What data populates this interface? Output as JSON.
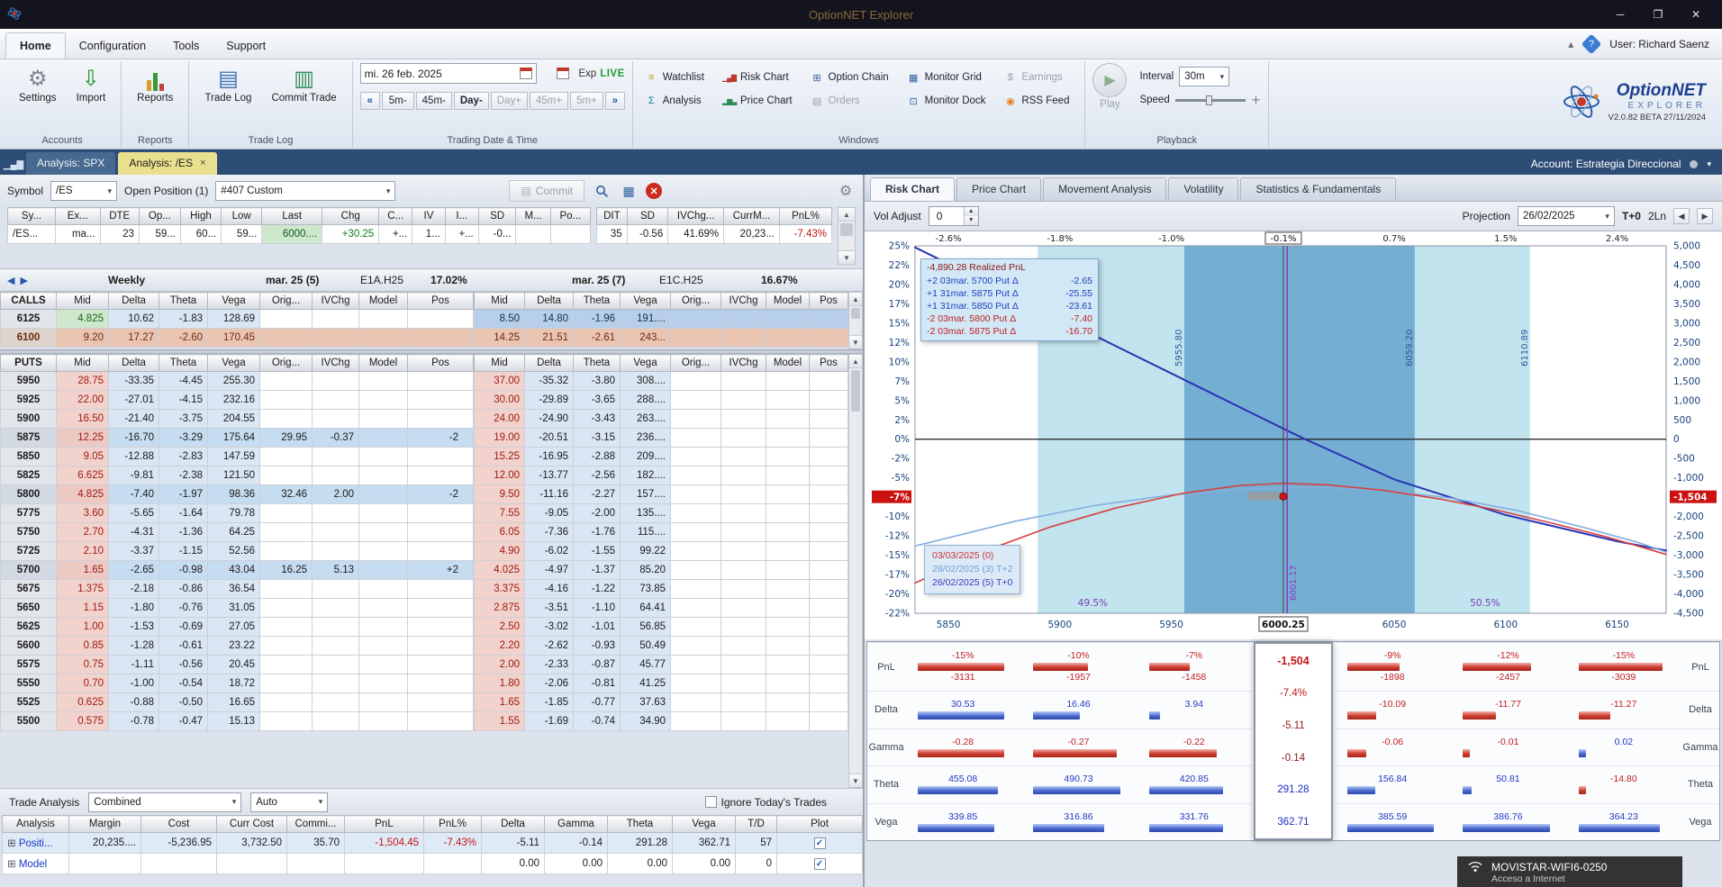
{
  "window": {
    "title": "OptionNET Explorer",
    "user": "User: Richard Saenz",
    "account": "Account: Estrategia Direccional"
  },
  "menubar": {
    "items": [
      "Home",
      "Configuration",
      "Tools",
      "Support"
    ]
  },
  "icons": {
    "settings": "⚙",
    "import": "⇩",
    "trade_log": "▤",
    "commit_trade": "▥",
    "watchlist": "≡",
    "risk_chart": "▁▄▇",
    "option_chain": "⊞",
    "monitor_grid": "▦",
    "earnings": "$",
    "analysis": "Σ",
    "price_chart": "▂▆▃",
    "orders": "▤",
    "monitor_dock": "⊡",
    "rss_feed": "◉",
    "play": "▶",
    "gear": "⚙",
    "grid": "▦",
    "close_red": "✕",
    "doc": "▤",
    "chart_tab": "▁▄▇"
  },
  "ribbon": {
    "groups": {
      "accounts": "Accounts",
      "reports": "Reports",
      "trade_log": "Trade Log",
      "date_time": "Trading Date & Time",
      "windows": "Windows",
      "playback": "Playback"
    },
    "buttons": {
      "settings": "Settings",
      "import": "Import",
      "reports": "Reports",
      "trade_log": "Trade Log",
      "commit_trade": "Commit Trade"
    },
    "date_time": {
      "date": "mi. 26 feb. 2025",
      "exp": "Exp",
      "live": "LIVE",
      "nav_back": "«",
      "nav_fwd": "»",
      "nav": [
        "5m-",
        "45m-",
        "Day-",
        "Day+",
        "45m+",
        "5m+"
      ]
    },
    "windows_row1": [
      "Watchlist",
      "Risk Chart",
      "Option Chain",
      "Monitor Grid",
      "Earnings"
    ],
    "windows_row2": [
      "Analysis",
      "Price Chart",
      "Orders",
      "Monitor Dock",
      "RSS Feed"
    ],
    "playback": {
      "play": "Play",
      "interval_label": "Interval",
      "interval_value": "30m",
      "speed_label": "Speed"
    },
    "logo": {
      "name": "OptionNET",
      "sub": "EXPLORER",
      "version": "V2.0.82 BETA 27/11/2024"
    }
  },
  "doc_tabs": {
    "spx": "Analysis: SPX",
    "es": "Analysis: /ES",
    "close": "×"
  },
  "position_bar": {
    "symbol_label": "Symbol",
    "symbol_value": "/ES",
    "open_position": "Open Position (1)",
    "strategy": "#407 Custom",
    "commit": "Commit"
  },
  "summary_table": {
    "cols_left": [
      "Sy...",
      "Ex...",
      "DTE",
      "Op...",
      "High",
      "Low",
      "Last",
      "Chg",
      "C...",
      "IV",
      "I...",
      "SD",
      "M...",
      "Po..."
    ],
    "rows_left": [
      [
        "/ES...",
        "ma...",
        "23",
        "59...",
        "60...",
        "59...",
        "6000....",
        "+30.25",
        "+...",
        "1...",
        "+...",
        "-0...",
        "",
        ""
      ]
    ],
    "cols_right": [
      "DIT",
      "SD",
      "IVChg...",
      "CurrM...",
      "PnL%"
    ],
    "rows_right": [
      [
        "35",
        "-0.56",
        "41.69%",
        "20,23...",
        "-7.43%"
      ]
    ]
  },
  "expiry_bar": {
    "cycle": "Weekly",
    "left_date": "mar. 25 (5)",
    "left_code": "E1A.H25",
    "left_iv": "17.02%",
    "right_date": "mar. 25 (7)",
    "right_code": "E1C.H25",
    "right_iv": "16.67%"
  },
  "option_tables": {
    "calls_label": "CALLS",
    "puts_label": "PUTS",
    "cols": [
      "Mid",
      "Delta",
      "Theta",
      "Vega",
      "Orig...",
      "IVChg",
      "Model",
      "Pos"
    ],
    "calls_left": [
      {
        "c": [
          "6125",
          "4.825",
          "10.62",
          "-1.83",
          "128.69",
          "",
          "",
          "",
          ""
        ]
      },
      {
        "c": [
          "6100",
          "9.20",
          "17.27",
          "-2.60",
          "170.45",
          "",
          "",
          "",
          ""
        ],
        "hl": "itm"
      }
    ],
    "calls_right": [
      {
        "c": [
          "8.50",
          "14.80",
          "-1.96",
          "191....",
          "",
          "",
          "",
          ""
        ],
        "hl": "sel"
      },
      {
        "c": [
          "14.25",
          "21.51",
          "-2.61",
          "243...",
          "",
          "",
          "",
          ""
        ],
        "hl": "itm"
      }
    ],
    "puts_left": [
      {
        "c": [
          "5950",
          "28.75",
          "-33.35",
          "-4.45",
          "255.30",
          "",
          "",
          "",
          ""
        ]
      },
      {
        "c": [
          "5925",
          "22.00",
          "-27.01",
          "-4.15",
          "232.16",
          "",
          "",
          "",
          ""
        ]
      },
      {
        "c": [
          "5900",
          "16.50",
          "-21.40",
          "-3.75",
          "204.55",
          "",
          "",
          "",
          ""
        ]
      },
      {
        "c": [
          "5875",
          "12.25",
          "-16.70",
          "-3.29",
          "175.64",
          "29.95",
          "-0.37",
          "",
          "-2"
        ],
        "hl": "pos"
      },
      {
        "c": [
          "5850",
          "9.05",
          "-12.88",
          "-2.83",
          "147.59",
          "",
          "",
          "",
          ""
        ]
      },
      {
        "c": [
          "5825",
          "6.625",
          "-9.81",
          "-2.38",
          "121.50",
          "",
          "",
          "",
          ""
        ]
      },
      {
        "c": [
          "5800",
          "4.825",
          "-7.40",
          "-1.97",
          "98.36",
          "32.46",
          "2.00",
          "",
          "-2"
        ],
        "hl": "pos"
      },
      {
        "c": [
          "5775",
          "3.60",
          "-5.65",
          "-1.64",
          "79.78",
          "",
          "",
          "",
          ""
        ]
      },
      {
        "c": [
          "5750",
          "2.70",
          "-4.31",
          "-1.36",
          "64.25",
          "",
          "",
          "",
          ""
        ]
      },
      {
        "c": [
          "5725",
          "2.10",
          "-3.37",
          "-1.15",
          "52.56",
          "",
          "",
          "",
          ""
        ]
      },
      {
        "c": [
          "5700",
          "1.65",
          "-2.65",
          "-0.98",
          "43.04",
          "16.25",
          "5.13",
          "",
          "+2"
        ],
        "hl": "pos"
      },
      {
        "c": [
          "5675",
          "1.375",
          "-2.18",
          "-0.86",
          "36.54",
          "",
          "",
          "",
          ""
        ]
      },
      {
        "c": [
          "5650",
          "1.15",
          "-1.80",
          "-0.76",
          "31.05",
          "",
          "",
          "",
          ""
        ]
      },
      {
        "c": [
          "5625",
          "1.00",
          "-1.53",
          "-0.69",
          "27.05",
          "",
          "",
          "",
          ""
        ]
      },
      {
        "c": [
          "5600",
          "0.85",
          "-1.28",
          "-0.61",
          "23.22",
          "",
          "",
          "",
          ""
        ]
      },
      {
        "c": [
          "5575",
          "0.75",
          "-1.11",
          "-0.56",
          "20.45",
          "",
          "",
          "",
          ""
        ]
      },
      {
        "c": [
          "5550",
          "0.70",
          "-1.00",
          "-0.54",
          "18.72",
          "",
          "",
          "",
          ""
        ]
      },
      {
        "c": [
          "5525",
          "0.625",
          "-0.88",
          "-0.50",
          "16.65",
          "",
          "",
          "",
          ""
        ]
      },
      {
        "c": [
          "5500",
          "0.575",
          "-0.78",
          "-0.47",
          "15.13",
          "",
          "",
          "",
          ""
        ]
      }
    ],
    "puts_right": [
      {
        "c": [
          "37.00",
          "-35.32",
          "-3.80",
          "308....",
          "",
          "",
          "",
          ""
        ]
      },
      {
        "c": [
          "30.00",
          "-29.89",
          "-3.65",
          "288....",
          "",
          "",
          "",
          ""
        ]
      },
      {
        "c": [
          "24.00",
          "-24.90",
          "-3.43",
          "263....",
          "",
          "",
          "",
          ""
        ]
      },
      {
        "c": [
          "19.00",
          "-20.51",
          "-3.15",
          "236....",
          "",
          "",
          "",
          ""
        ]
      },
      {
        "c": [
          "15.25",
          "-16.95",
          "-2.88",
          "209....",
          "",
          "",
          "",
          ""
        ]
      },
      {
        "c": [
          "12.00",
          "-13.77",
          "-2.56",
          "182....",
          "",
          "",
          "",
          ""
        ]
      },
      {
        "c": [
          "9.50",
          "-11.16",
          "-2.27",
          "157....",
          "",
          "",
          "",
          ""
        ]
      },
      {
        "c": [
          "7.55",
          "-9.05",
          "-2.00",
          "135....",
          "",
          "",
          "",
          ""
        ]
      },
      {
        "c": [
          "6.05",
          "-7.36",
          "-1.76",
          "115....",
          "",
          "",
          "",
          ""
        ]
      },
      {
        "c": [
          "4.90",
          "-6.02",
          "-1.55",
          "99.22",
          "",
          "",
          "",
          ""
        ]
      },
      {
        "c": [
          "4.025",
          "-4.97",
          "-1.37",
          "85.20",
          "",
          "",
          "",
          ""
        ]
      },
      {
        "c": [
          "3.375",
          "-4.16",
          "-1.22",
          "73.85",
          "",
          "",
          "",
          ""
        ]
      },
      {
        "c": [
          "2.875",
          "-3.51",
          "-1.10",
          "64.41",
          "",
          "",
          "",
          ""
        ]
      },
      {
        "c": [
          "2.50",
          "-3.02",
          "-1.01",
          "56.85",
          "",
          "",
          "",
          ""
        ]
      },
      {
        "c": [
          "2.20",
          "-2.62",
          "-0.93",
          "50.49",
          "",
          "",
          "",
          ""
        ]
      },
      {
        "c": [
          "2.00",
          "-2.33",
          "-0.87",
          "45.77",
          "",
          "",
          "",
          ""
        ]
      },
      {
        "c": [
          "1.80",
          "-2.06",
          "-0.81",
          "41.25",
          "",
          "",
          "",
          ""
        ]
      },
      {
        "c": [
          "1.65",
          "-1.85",
          "-0.77",
          "37.63",
          "",
          "",
          "",
          ""
        ]
      },
      {
        "c": [
          "1.55",
          "-1.69",
          "-0.74",
          "34.90",
          "",
          "",
          "",
          ""
        ]
      }
    ]
  },
  "trade_analysis": {
    "label": "Trade Analysis",
    "combined": "Combined",
    "auto": "Auto",
    "ignore": "Ignore Today's Trades"
  },
  "analysis_table": {
    "cols": [
      "Analysis",
      "Margin",
      "Cost",
      "Curr Cost",
      "Commi...",
      "PnL",
      "PnL%",
      "Delta",
      "Gamma",
      "Theta",
      "Vega",
      "T/D",
      "Plot"
    ],
    "rows": [
      {
        "c": [
          "Positi...",
          "20,235....",
          "-5,236.95",
          "3,732.50",
          "35.70",
          "-1,504.45",
          "-7.43%",
          "-5.11",
          "-0.14",
          "291.28",
          "362.71",
          "57",
          "✓"
        ],
        "hl": "sel2"
      },
      {
        "c": [
          "Model",
          "",
          "",
          "",
          "",
          "",
          "",
          "0.00",
          "0.00",
          "0.00",
          "0.00",
          "0",
          "✓"
        ]
      }
    ]
  },
  "right_panel": {
    "tabs": [
      "Risk Chart",
      "Price Chart",
      "Movement Analysis",
      "Volatility",
      "Statistics & Fundamentals"
    ],
    "vol_adjust_label": "Vol Adjust",
    "vol_adjust_value": "0",
    "projection_label": "Projection",
    "projection_date": "26/02/2025",
    "t_label": "T+0",
    "lines_label": "2Ln"
  },
  "chart_data": {
    "type": "line",
    "title": "Risk Chart — P&L vs Underlying Price",
    "x_range": [
      5835,
      6172
    ],
    "y_range_pct": [
      -22.5,
      25
    ],
    "x_ticks": [
      5850,
      5900,
      5950,
      6000.25,
      6050,
      6100,
      6150
    ],
    "x_tick_labels": [
      "5850",
      "5900",
      "5950",
      "6000.25",
      "6050",
      "6100",
      "6150"
    ],
    "current_tick_index": 3,
    "top_labels": [
      "-2.6%",
      "-1.8%",
      "-1.0%",
      "-0.1%",
      "0.7%",
      "1.5%",
      "2.4%"
    ],
    "y_left_labels": [
      "25%",
      "22%",
      "20%",
      "17%",
      "15%",
      "12%",
      "10%",
      "7%",
      "5%",
      "2%",
      "0%",
      "-2%",
      "-5%",
      "-7%",
      "-10%",
      "-12%",
      "-15%",
      "-17%",
      "-20%",
      "-22%"
    ],
    "y_right_labels": [
      "5,000",
      "4,500",
      "4,000",
      "3,500",
      "3,000",
      "2,500",
      "2,000",
      "1,500",
      "1,000",
      "500",
      "0",
      "-500",
      "-1,000",
      "-1,500",
      "-2,000",
      "-2,500",
      "-3,000",
      "-3,500",
      "-4,000",
      "-4,500"
    ],
    "highlight_index": 13,
    "left_badge": "-7%",
    "right_badge": "-1,504",
    "bands": {
      "light": [
        5890,
        6110.89
      ],
      "dark": [
        5955.8,
        6059.2
      ],
      "labels": [
        [
          "5955.80",
          5955.8
        ],
        [
          "6059.20",
          6059.2
        ],
        [
          "6110.89",
          6110.89
        ]
      ],
      "prob_left": {
        "text": "49.5%",
        "price": 5908
      },
      "prob_right": {
        "text": "50.5%",
        "price": 6084
      }
    },
    "current_price_line": {
      "price": 6000.25,
      "purple_price": 6001.17,
      "purple_label": "6001.17"
    },
    "marker": {
      "price": 6000.25,
      "pnl_pct": -7.4
    },
    "series": [
      {
        "name": "26/02/2025 (5) T+0",
        "color": "#2b35b5",
        "width": 2,
        "points": [
          [
            5835,
            24.8
          ],
          [
            5900,
            15.6
          ],
          [
            5950,
            8.5
          ],
          [
            6000,
            1.4
          ],
          [
            6010,
            0
          ],
          [
            6050,
            -5.2
          ],
          [
            6100,
            -9.8
          ],
          [
            6150,
            -13.2
          ],
          [
            6172,
            -14.4
          ]
        ]
      },
      {
        "name": "28/02/2025 (3) T+2",
        "color": "#85aee0",
        "width": 1.6,
        "points": [
          [
            5835,
            -13.8
          ],
          [
            5880,
            -10.6
          ],
          [
            5915,
            -8.6
          ],
          [
            5950,
            -7.2
          ],
          [
            5985,
            -6.4
          ],
          [
            6015,
            -6.2
          ],
          [
            6045,
            -6.6
          ],
          [
            6075,
            -7.6
          ],
          [
            6105,
            -9.2
          ],
          [
            6135,
            -11.4
          ],
          [
            6160,
            -13.4
          ],
          [
            6172,
            -14.6
          ]
        ]
      },
      {
        "name": "03/03/2025 (0)",
        "color": "#d84040",
        "width": 1.6,
        "points": [
          [
            5835,
            -18.6
          ],
          [
            5865,
            -14.6
          ],
          [
            5895,
            -11.4
          ],
          [
            5925,
            -8.9
          ],
          [
            5955,
            -7.0
          ],
          [
            5980,
            -6.0
          ],
          [
            6000,
            -5.7
          ],
          [
            6020,
            -5.9
          ],
          [
            6045,
            -6.6
          ],
          [
            6070,
            -7.7
          ],
          [
            6095,
            -9.1
          ],
          [
            6120,
            -10.8
          ],
          [
            6145,
            -12.6
          ],
          [
            6172,
            -14.9
          ]
        ]
      }
    ],
    "legend": {
      "realized": "-4,890.28 Realized PnL",
      "trades": [
        {
          "text": "+2 03mar. 5700 Put Δ",
          "value": "-2.65",
          "side": "long"
        },
        {
          "text": "+1 31mar. 5875 Put Δ",
          "value": "-25.55",
          "side": "long"
        },
        {
          "text": "+1 31mar. 5850 Put Δ",
          "value": "-23.61",
          "side": "long"
        },
        {
          "text": "-2 03mar. 5800 Put Δ",
          "value": "-7.40",
          "side": "short"
        },
        {
          "text": "-2 03mar. 5875 Put Δ",
          "value": "-16.70",
          "side": "short"
        }
      ]
    },
    "date_box": [
      {
        "text": "03/03/2025 (0)",
        "color": "#cc3333"
      },
      {
        "text": "28/02/2025 (3) T+2",
        "color": "#6f9fd8"
      },
      {
        "text": "26/02/2025 (5) T+0",
        "color": "#3a3ab5"
      }
    ]
  },
  "greeks": {
    "labels": [
      "PnL",
      "Delta",
      "Gamma",
      "Theta",
      "Vega"
    ],
    "center": {
      "price": "6000.25",
      "values": [
        "-1,504",
        "-7.4%",
        "-5.11",
        "-0.14",
        "291.28",
        "362.71"
      ]
    },
    "columns": [
      {
        "pnl_pct": "-15%",
        "pnl": "-3131",
        "delta": "30.53",
        "gamma": "-0.28",
        "theta": "455.08",
        "vega": "339.85"
      },
      {
        "pnl_pct": "-10%",
        "pnl": "-1957",
        "delta": "16.46",
        "gamma": "-0.27",
        "theta": "490.73",
        "vega": "316.86"
      },
      {
        "pnl_pct": "-7%",
        "pnl": "-1458",
        "delta": "3.94",
        "gamma": "-0.22",
        "theta": "420.85",
        "vega": "331.76"
      },
      {
        "pnl_pct": "-9%",
        "pnl": "-1898",
        "delta": "-10.09",
        "gamma": "-0.06",
        "theta": "156.84",
        "vega": "385.59"
      },
      {
        "pnl_pct": "-12%",
        "pnl": "-2457",
        "delta": "-11.77",
        "gamma": "-0.01",
        "theta": "50.81",
        "vega": "386.76"
      },
      {
        "pnl_pct": "-15%",
        "pnl": "-3039",
        "delta": "-11.27",
        "gamma": "0.02",
        "theta": "-14.80",
        "vega": "364.23"
      }
    ]
  },
  "network_popup": {
    "ssid": "MOVISTAR-WIFI6-0250",
    "subtitle": "Acceso a Internet"
  }
}
